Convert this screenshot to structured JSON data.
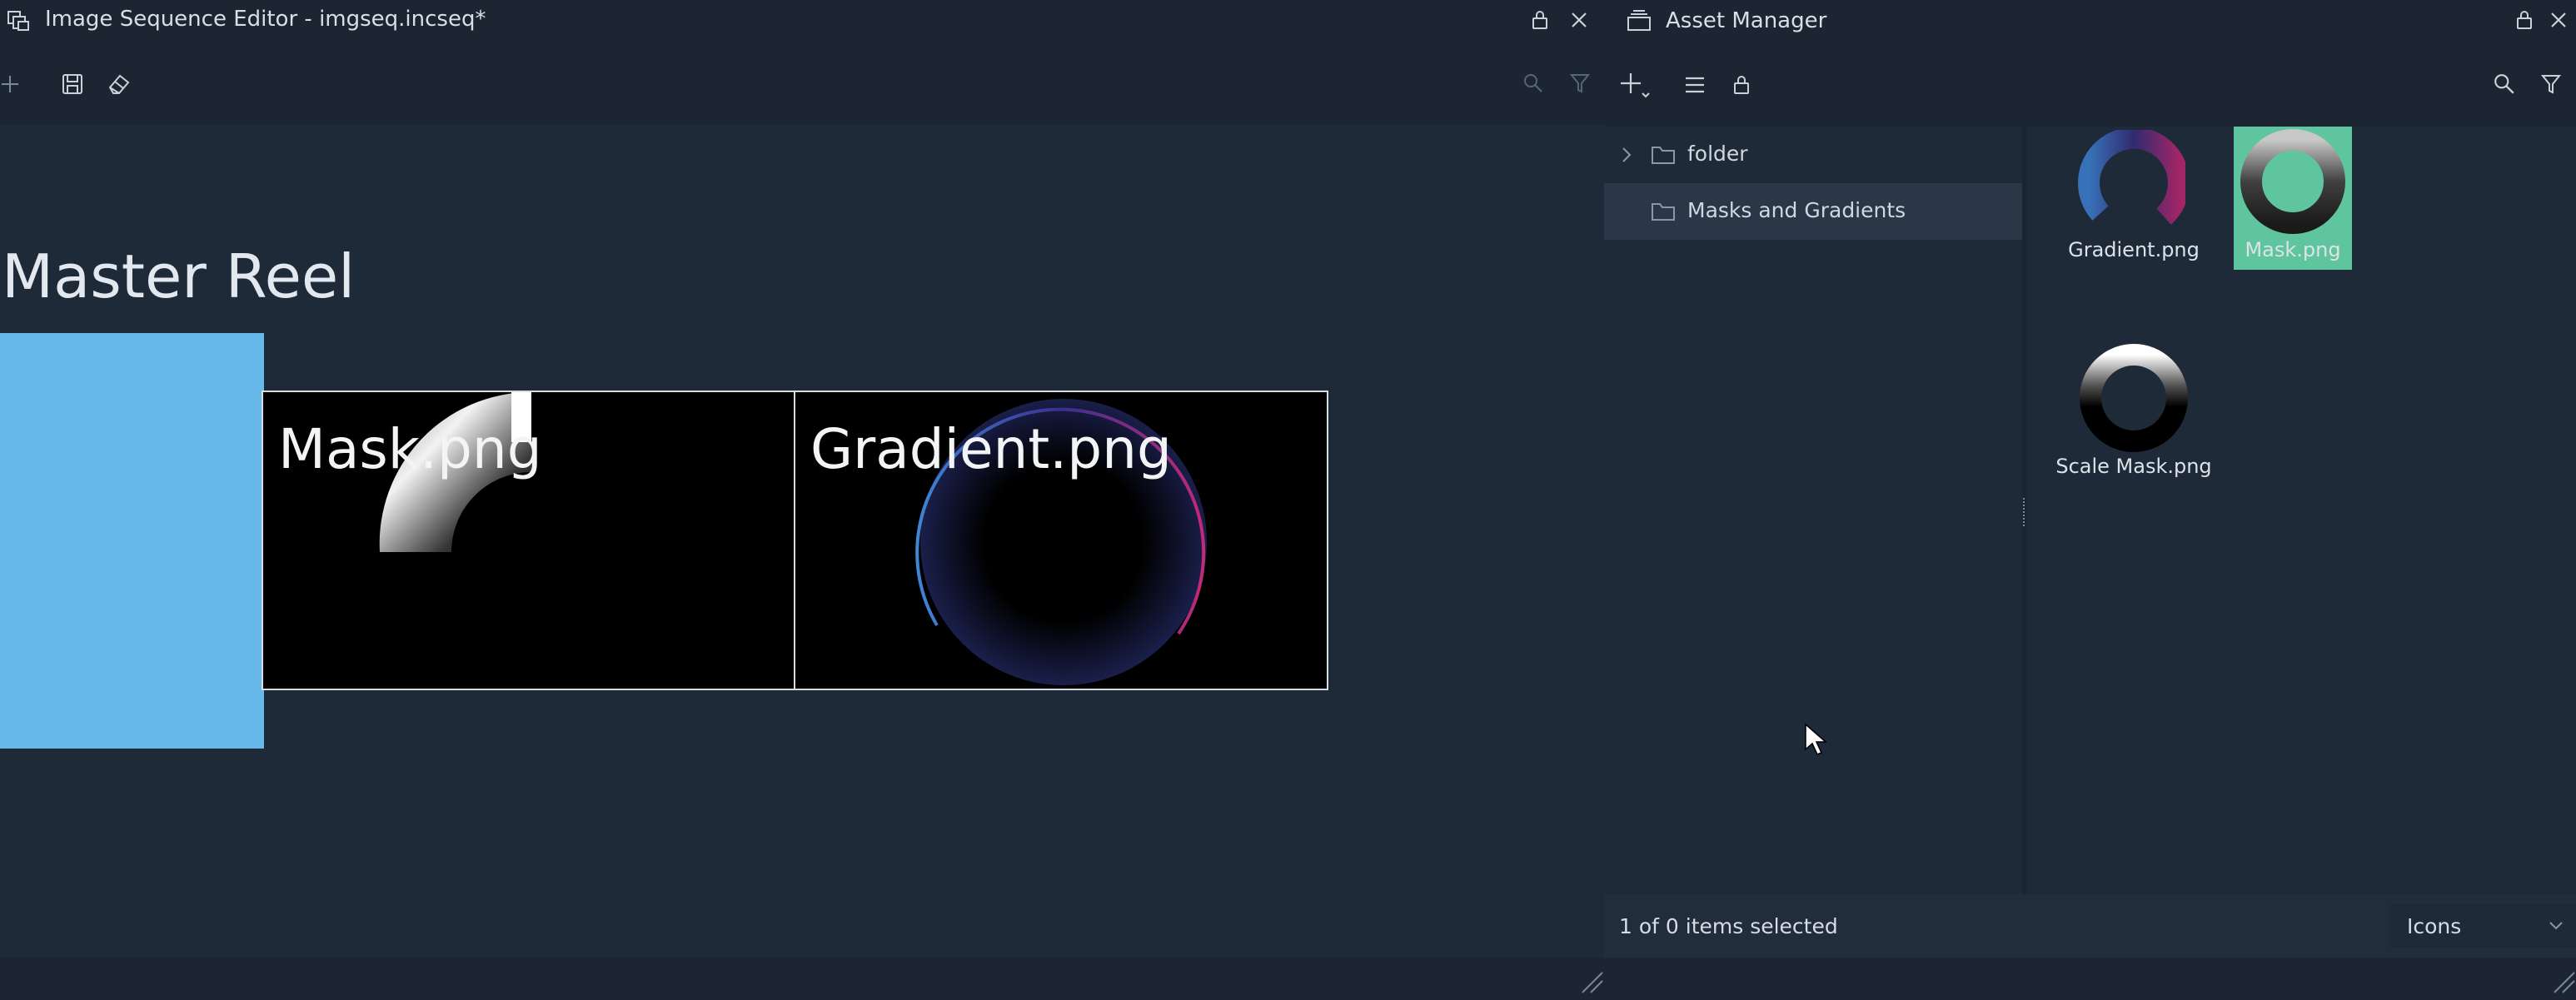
{
  "left_panel": {
    "title": "Image Sequence Editor - imgseq.incseq*",
    "reel_title": "Master Reel",
    "clips": [
      {
        "label": "Mask.png"
      },
      {
        "label": "Gradient.png"
      }
    ]
  },
  "right_panel": {
    "title": "Asset Manager",
    "tree": [
      {
        "label": "folder",
        "expandable": true
      },
      {
        "label": "Masks and Gradients",
        "selected": true
      }
    ],
    "assets": [
      {
        "label": "Gradient.png",
        "selected": false
      },
      {
        "label": "Mask.png",
        "selected": true
      },
      {
        "label": "Scale Mask.png",
        "selected": false
      }
    ],
    "status": "1 of 0 items selected",
    "view_mode": "Icons"
  },
  "colors": {
    "background": "#1f2a38",
    "bar": "#1c2532",
    "tree_selected": "#2b3747",
    "blue_block": "#67b9ea",
    "asset_selected": "#5fc59e"
  },
  "icons": [
    "panel-icon",
    "lock-icon",
    "close-icon",
    "plus-icon",
    "save-icon",
    "eraser-icon",
    "search-icon",
    "filter-icon",
    "list-icon",
    "chevron-right-icon",
    "folder-icon",
    "chevron-down-icon",
    "resize-grip-icon"
  ]
}
